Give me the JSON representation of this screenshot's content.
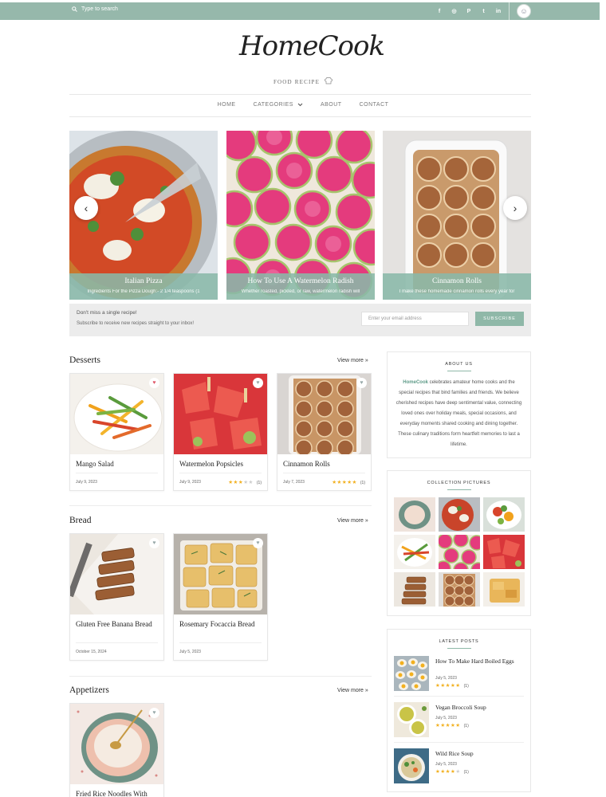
{
  "topbar": {
    "search_placeholder": "Type to search",
    "socials": [
      "f",
      "◎",
      "P",
      "t",
      "in"
    ]
  },
  "header": {
    "logo": "HomeCook",
    "tagline": "FOOD RECIPE"
  },
  "nav": {
    "items": [
      "HOME",
      "CATEGORIES",
      "ABOUT",
      "CONTACT"
    ]
  },
  "slider": {
    "slides": [
      {
        "title": "Italian Pizza",
        "desc": "Ingredients For the Pizza Dough:- 2 1/4 teaspoons (1"
      },
      {
        "title": "How To Use A Watermelon Radish",
        "desc": "Whether roasted, pickled, or raw, watermelon radish will"
      },
      {
        "title": "Cinnamon Rolls",
        "desc": "I make these homemade cinnamon rolls every year for"
      }
    ]
  },
  "newsletter": {
    "title": "Don't miss a single recipe!",
    "subtitle": "Subscribe to receive new recipes straight to your inbox!",
    "placeholder": "Enter your email address",
    "button": "SUBSCRIBE"
  },
  "sections": {
    "view_more": "View more",
    "desserts": {
      "title": "Desserts",
      "cards": [
        {
          "title": "Mango Salad",
          "date": "July 9, 2023",
          "rating": 0,
          "count": ""
        },
        {
          "title": "Watermelon Popsicles",
          "date": "July 9, 2023",
          "rating": 3,
          "count": "(1)"
        },
        {
          "title": "Cinnamon Rolls",
          "date": "July 7, 2023",
          "rating": 5,
          "count": "(1)"
        }
      ]
    },
    "bread": {
      "title": "Bread",
      "cards": [
        {
          "title": "Gluten Free Banana Bread",
          "date": "October 15, 2024"
        },
        {
          "title": "Rosemary Focaccia Bread",
          "date": "July 5, 2023"
        }
      ]
    },
    "appetizers": {
      "title": "Appetizers",
      "cards": [
        {
          "title": "Fried Rice Noodles With"
        }
      ]
    }
  },
  "sidebar": {
    "about": {
      "title": "ABOUT US",
      "brand": "HomeCook",
      "text": " celebrates amateur home cooks and the special recipes that bind families and friends. We believe cherished recipes have deep sentimental value, connecting loved ones over holiday meals, special occasions, and everyday moments shared cooking and dining together. These culinary traditions form heartfelt memories to last a lifetime."
    },
    "collection": {
      "title": "COLLECTION PICTURES"
    },
    "latest": {
      "title": "LATEST POSTS",
      "posts": [
        {
          "title": "How To Make Hard Boiled Eggs",
          "date": "July 5, 2023",
          "count": "(1)"
        },
        {
          "title": "Vegan Broccoli Soup",
          "date": "July 5, 2023",
          "count": "(1)"
        },
        {
          "title": "Wild Rice Soup",
          "date": "July 5, 2023",
          "count": "(1)"
        }
      ]
    }
  },
  "colors": {
    "accent": "#96b8ab",
    "star": "#f2b01e",
    "heart": "#e05a6a"
  }
}
